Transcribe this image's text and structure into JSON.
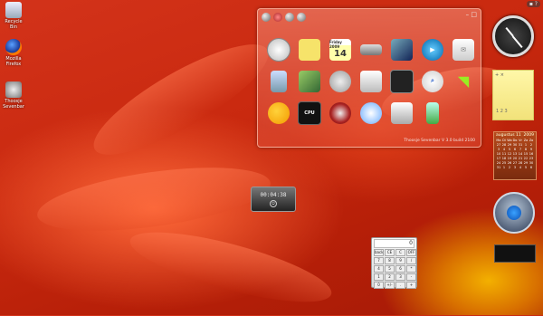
{
  "desktop": {
    "icons": [
      {
        "label": "Recycle Bin",
        "icon": "recycle-bin-icon"
      },
      {
        "label": "Mozilla Firefox",
        "icon": "firefox-icon"
      },
      {
        "label": "Thoosje Sevenbar",
        "icon": "sevenbar-icon"
      }
    ],
    "tray_text": "▪ ?"
  },
  "panel": {
    "footer": "Thoosje Sevenbar V 3.0 build 2100",
    "controls": "– □",
    "calendar_tile": {
      "month": "Friday 2009",
      "day": "14"
    },
    "icons": [
      "clock-icon",
      "sticky-notes-icon",
      "calendar-icon",
      "network-icon",
      "slideshow-icon",
      "media-player-icon",
      "mail-icon",
      "recycle-bin-icon",
      "picture-puzzle-icon",
      "weather-search-icon",
      "feed-headlines-icon",
      "control-panel-icon",
      "search-icon",
      "wifi-icon",
      "weather-icon",
      "cpu-meter-icon",
      "sevenbar-icon",
      "currency-icon",
      "calculator-icon",
      "battery-icon",
      ""
    ],
    "cpu_label": "CPU"
  },
  "stopwatch": {
    "time": "00:04:38"
  },
  "calculator": {
    "display": "0",
    "keys": [
      "back",
      "CE",
      "C",
      "OFF",
      "7",
      "8",
      "9",
      "/",
      "4",
      "5",
      "6",
      "*",
      "1",
      "2",
      "3",
      "-",
      "0",
      "+/-",
      ".",
      "+"
    ]
  },
  "sidebar": {
    "notes_text": "1 2 3",
    "calendar": {
      "month": "augustus 11",
      "year": "2009",
      "weekdays": [
        "Ma",
        "Di",
        "Wo",
        "Do",
        "Vr",
        "Za",
        "Zo"
      ],
      "days": [
        "27",
        "28",
        "29",
        "30",
        "31",
        "1",
        "2",
        "3",
        "4",
        "5",
        "6",
        "7",
        "8",
        "9",
        "10",
        "11",
        "12",
        "13",
        "14",
        "15",
        "16",
        "17",
        "18",
        "19",
        "20",
        "21",
        "22",
        "23",
        "24",
        "25",
        "26",
        "27",
        "28",
        "29",
        "30",
        "31",
        "1",
        "2",
        "3",
        "4",
        "5",
        "6"
      ]
    }
  }
}
